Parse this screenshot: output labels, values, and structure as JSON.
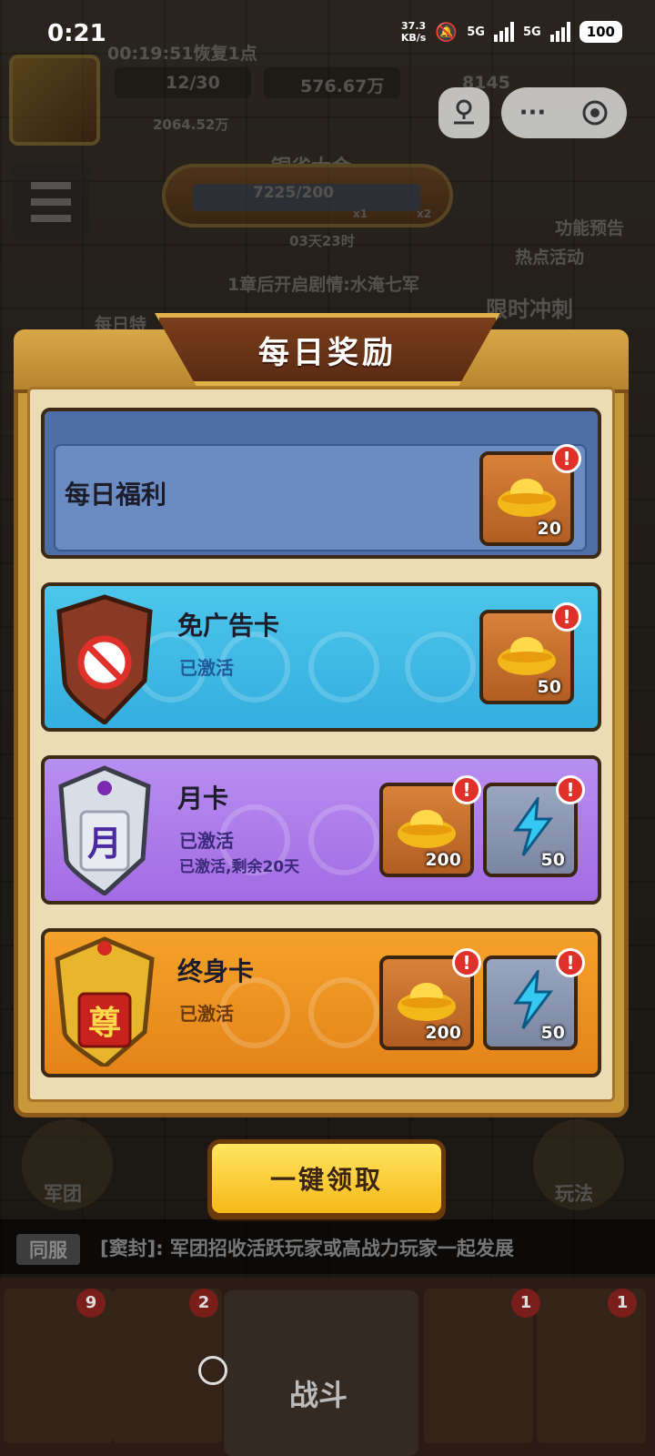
{
  "status_bar": {
    "time": "0:21",
    "net_speed_value": "37.3",
    "net_speed_unit": "KB/s",
    "signal1": "5G",
    "signal2": "5G",
    "battery": "100"
  },
  "hud": {
    "recover_timer": "00:19:51恢复1点",
    "energy": "12/30",
    "copper": "576.67万",
    "gold": "8145",
    "power": "2064.52万",
    "event_title": "铜雀大会",
    "event_progress": "7225/200",
    "event_mult1": "x1",
    "event_mult2": "x2",
    "event_timer": "03天23时",
    "feature_preview": "功能预告",
    "hot_events": "热点活动",
    "chapter_hint": "1章后开启剧情:水淹七军",
    "limited_sprint": "限时冲刺",
    "daily_special": "每日特"
  },
  "dialog": {
    "title": "每日奖励",
    "cards": [
      {
        "label": "每日福利",
        "rewards": [
          {
            "type": "gold-ingot",
            "amount": "20",
            "alert": "!"
          }
        ]
      },
      {
        "label": "免广告卡",
        "status": "已激活",
        "rewards": [
          {
            "type": "gold-ingot",
            "amount": "50",
            "alert": "!"
          }
        ]
      },
      {
        "label": "月卡",
        "badge_char": "月",
        "status": "已激活",
        "sub": "已激活,剩余20天",
        "rewards": [
          {
            "type": "gold-ingot",
            "amount": "200",
            "alert": "!"
          },
          {
            "type": "energy",
            "amount": "50",
            "alert": "!"
          }
        ]
      },
      {
        "label": "终身卡",
        "badge_char": "尊",
        "status": "已激活",
        "rewards": [
          {
            "type": "gold-ingot",
            "amount": "200",
            "alert": "!"
          },
          {
            "type": "energy",
            "amount": "50",
            "alert": "!"
          }
        ]
      }
    ],
    "claim_all": "一键领取"
  },
  "bottom": {
    "legion": "军团",
    "gameplay": "玩法",
    "chat_channel": "同服",
    "chat_message": "[窦封]: 军团招收活跃玩家或高战力玩家一起发展",
    "battle_tab": "战斗",
    "tab_counts": [
      "9",
      "2",
      "1",
      "1"
    ]
  },
  "colors": {
    "panel_bg": "#ecdcb6",
    "daily_card": "#4e6ea8",
    "noad_card": "#35aee0",
    "month_card": "#a26be4",
    "life_card": "#e48318",
    "claim_button": "#f6b91a"
  }
}
